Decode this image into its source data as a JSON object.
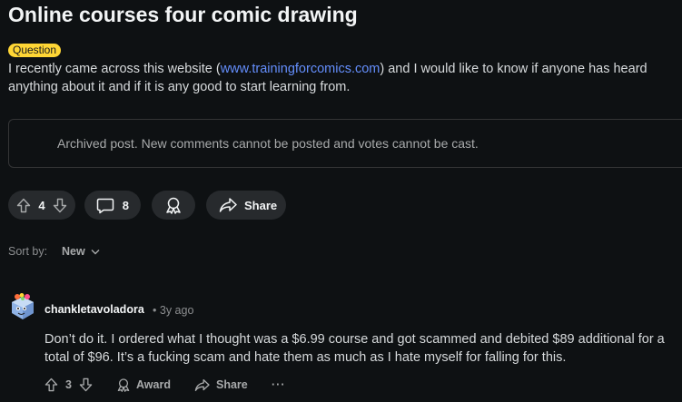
{
  "post": {
    "title": "Online courses four comic drawing",
    "flair": "Question",
    "body_before_link": "I recently came across this website (",
    "body_link": "www.trainingforcomics.com",
    "body_after_link": ") and I would like to know if anyone has heard anything about it and if it is any good to start learning from.",
    "archived_notice": "Archived post. New comments cannot be posted and votes cannot be cast."
  },
  "actions": {
    "vote_count": "4",
    "comment_count": "8",
    "share_label": "Share"
  },
  "sort": {
    "label": "Sort by:",
    "value": "New"
  },
  "comments": [
    {
      "author": "chankletavoladora",
      "separator": "•",
      "time": "3y ago",
      "text": "Don’t do it. I ordered what I thought was a $6.99 course and got scammed and debited $89 additional for a total of $96. It’s a fucking scam and hate them as much as I hate myself for falling for this.",
      "votes": "3",
      "award_label": "Award",
      "share_label": "Share",
      "more_label": "···"
    }
  ],
  "colors": {
    "background": "#0e1113",
    "pill": "#272a2d",
    "flair": "#ffd635",
    "link": "#648efc",
    "border": "#343536"
  },
  "icons": [
    "upvote-icon",
    "downvote-icon",
    "comment-icon",
    "award-icon",
    "share-icon",
    "chevron-down-icon",
    "more-icon"
  ]
}
